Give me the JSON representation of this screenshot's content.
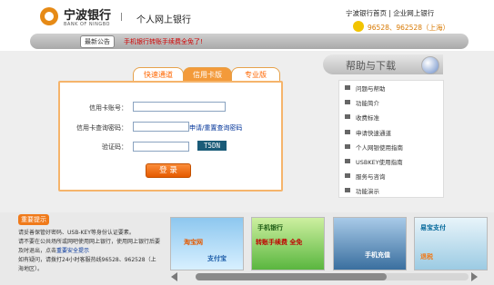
{
  "header": {
    "logo_cn": "宁波银行",
    "logo_en": "BANK OF NINGBO",
    "divider": "|",
    "site_title": "个人网上银行",
    "top_links": "宁波银行首页 | 企业网上银行",
    "phone": "96528、962528（上海）"
  },
  "notice": {
    "label": "最新公告",
    "text": "手机银行转账手续费全免了!"
  },
  "tabs": [
    {
      "label": "快速通道"
    },
    {
      "label": "信用卡版"
    },
    {
      "label": "专业版"
    }
  ],
  "login": {
    "card_label": "信用卡账号：",
    "card_value": "",
    "password_label": "信用卡查询密码：",
    "password_link": "申请/重置查询密码",
    "code_label": "验证码：",
    "captcha": "T5DN",
    "submit": "登 录"
  },
  "help": {
    "title": "帮助与下载",
    "items": [
      "问题与帮助",
      "功能简介",
      "收费标准",
      "申请快速通道",
      "个人网银使用指南",
      "USBKEY使用指南",
      "服务与咨询",
      "功能演示"
    ]
  },
  "tips": {
    "badge": "重要提示",
    "lines": [
      "请妥善保管好密码、USB-KEY等身份认证要素。",
      "请不要在公共场所或网吧使用网上银行，使用网上银行后要及时退出，点击",
      "重要安全提示",
      "如有疑问，请拨打24小时客服热线96528、962528（上海地区）。"
    ]
  },
  "banners": [
    {
      "text1": "淘宝网",
      "text2": "支付宝"
    },
    {
      "text1": "手机银行",
      "text2": "转账手续费 全免"
    },
    {
      "text1": "手机充值",
      "text2": ""
    },
    {
      "text1": "易宝支付",
      "text2": "退税"
    }
  ]
}
